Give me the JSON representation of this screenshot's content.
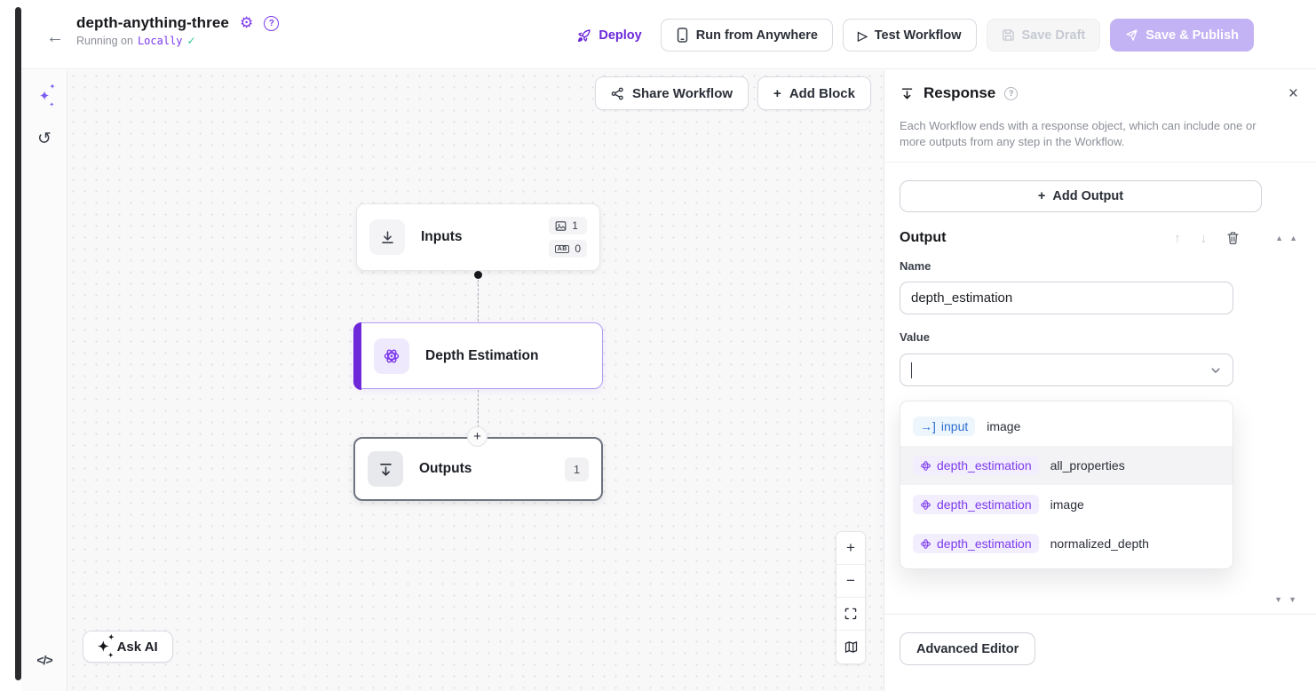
{
  "header": {
    "title": "depth-anything-three",
    "running_on_label": "Running on",
    "running_on_value": "Locally",
    "deploy_label": "Deploy",
    "run_from_anywhere_label": "Run from Anywhere",
    "test_workflow_label": "Test Workflow",
    "save_draft_label": "Save Draft",
    "save_publish_label": "Save & Publish"
  },
  "canvas": {
    "share_workflow_label": "Share Workflow",
    "add_block_label": "Add Block",
    "ask_ai_label": "Ask AI",
    "nodes": {
      "inputs": {
        "label": "Inputs",
        "image_count": "1",
        "param_count": "0",
        "param_chip": "AB"
      },
      "depth": {
        "label": "Depth Estimation"
      },
      "outputs": {
        "label": "Outputs",
        "count": "1"
      }
    }
  },
  "panel": {
    "title": "Response",
    "description": "Each Workflow ends with a response object, which can include one or more outputs from any step in the Workflow.",
    "add_output_label": "Add Output",
    "output_heading": "Output",
    "name_label": "Name",
    "name_value": "depth_estimation",
    "value_label": "Value",
    "value_input": "",
    "dropdown": {
      "options": [
        {
          "badge": "input",
          "property": "image"
        },
        {
          "badge": "depth_estimation",
          "property": "all_properties"
        },
        {
          "badge": "depth_estimation",
          "property": "image"
        },
        {
          "badge": "depth_estimation",
          "property": "normalized_depth"
        }
      ]
    },
    "advanced_editor_label": "Advanced Editor"
  },
  "icons": {
    "back": "←",
    "gear": "⚙",
    "help": "?",
    "play": "▷",
    "plus": "+",
    "minus": "−",
    "close": "×",
    "check": "✓",
    "arrow_up": "↑",
    "arrow_down": "↓",
    "tri_up": "▲",
    "tri_down": "▼",
    "code": "</>",
    "history": "↺",
    "sparkle_main": "✦",
    "sparkle_small": "✦",
    "input_arrow": "→]"
  },
  "colors": {
    "accent_purple": "#6d28d9",
    "light_purple": "#c3b2f4",
    "badge_blue": "#2d6fd2",
    "success_green": "#34c98e"
  }
}
